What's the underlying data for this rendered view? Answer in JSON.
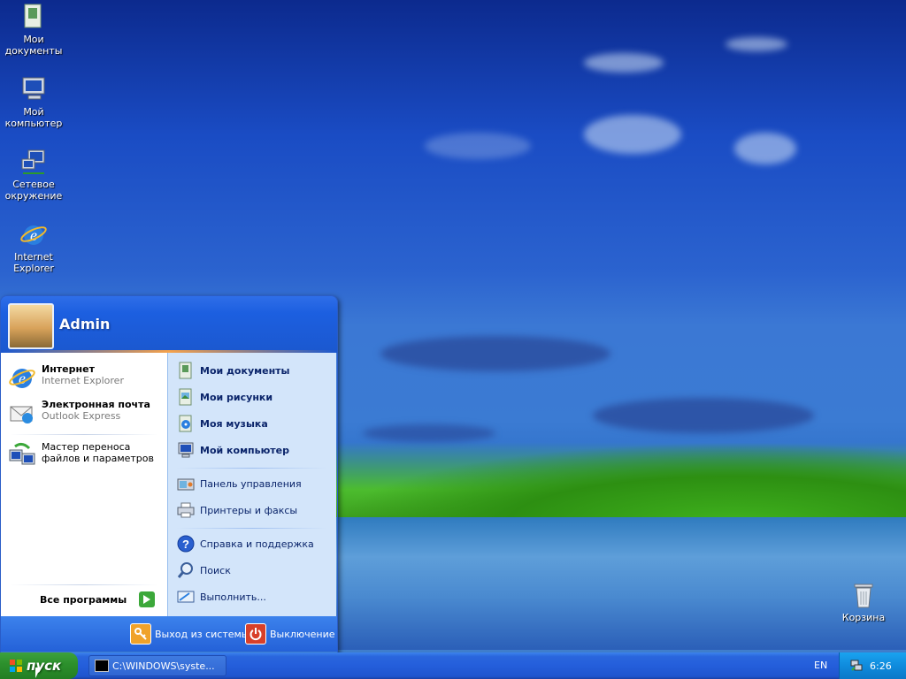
{
  "desktop": {
    "icons": [
      {
        "label": "Мои\nдокументы",
        "icon": "my-documents-icon"
      },
      {
        "label": "Мой\nкомпьютер",
        "icon": "my-computer-icon"
      },
      {
        "label": "Сетевое\nокружение",
        "icon": "network-places-icon"
      },
      {
        "label": "Internet\nExplorer",
        "icon": "internet-explorer-icon"
      },
      {
        "label": "Корзина",
        "icon": "recycle-bin-icon"
      }
    ]
  },
  "start_menu": {
    "user_name": "Admin",
    "pinned": [
      {
        "title": "Интернет",
        "subtitle": "Internet Explorer",
        "icon": "internet-explorer-icon"
      },
      {
        "title": "Электронная почта",
        "subtitle": "Outlook Express",
        "icon": "outlook-express-icon"
      }
    ],
    "recent": [
      {
        "title": "Мастер переноса файлов и параметров",
        "icon": "transfer-wizard-icon"
      }
    ],
    "all_programs": "Все программы",
    "right": [
      {
        "label": "Мои документы",
        "icon": "my-documents-icon",
        "bold": true
      },
      {
        "label": "Мои рисунки",
        "icon": "my-pictures-icon",
        "bold": true
      },
      {
        "label": "Моя музыка",
        "icon": "my-music-icon",
        "bold": true
      },
      {
        "label": "Мой компьютер",
        "icon": "my-computer-icon",
        "bold": true
      },
      {
        "label": "Панель управления",
        "icon": "control-panel-icon",
        "bold": false
      },
      {
        "label": "Принтеры и факсы",
        "icon": "printers-icon",
        "bold": false
      },
      {
        "label": "Справка и поддержка",
        "icon": "help-icon",
        "bold": false
      },
      {
        "label": "Поиск",
        "icon": "search-icon",
        "bold": false
      },
      {
        "label": "Выполнить...",
        "icon": "run-icon",
        "bold": false
      }
    ],
    "logoff": "Выход из системы",
    "shutdown": "Выключение"
  },
  "taskbar": {
    "start_label": "пуск",
    "task_button": "C:\\WINDOWS\\syste...",
    "language": "EN",
    "clock": "6:26"
  },
  "colors": {
    "accent": "#245edb",
    "start_green": "#2d912d",
    "tray_blue": "#0f8bdd"
  }
}
